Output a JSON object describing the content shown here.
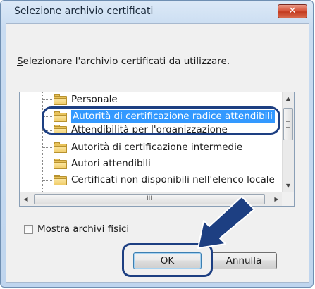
{
  "window": {
    "title": "Selezione archivio certificati",
    "close_glyph": "✕"
  },
  "prompt": {
    "accesskey": "S",
    "rest": "elezionare l'archivio certificati da utilizzare."
  },
  "tree": {
    "items": [
      {
        "label": "Personale",
        "selected": false
      },
      {
        "label": "Autorità di certificazione radice attendibili",
        "selected": true
      },
      {
        "label": "Attendibilità per l'organizzazione",
        "selected": false
      },
      {
        "label": "Autorità di certificazione intermedie",
        "selected": false
      },
      {
        "label": "Autori attendibili",
        "selected": false
      },
      {
        "label": "Certificati non disponibili nell'elenco locale",
        "selected": false
      }
    ],
    "hscroll_grip": "III"
  },
  "checkbox": {
    "accesskey": "M",
    "rest": "ostra archivi fisici",
    "checked": false
  },
  "buttons": {
    "ok_label": "OK",
    "cancel_label": "Annulla"
  },
  "colors": {
    "selection": "#3399ff",
    "callout": "#1d3f82",
    "close_button": "#c9452b"
  },
  "icons": [
    "folder-icon",
    "close-icon",
    "scroll-up-icon",
    "scroll-down-icon",
    "scroll-left-icon",
    "scroll-right-icon",
    "callout-arrow-icon"
  ]
}
